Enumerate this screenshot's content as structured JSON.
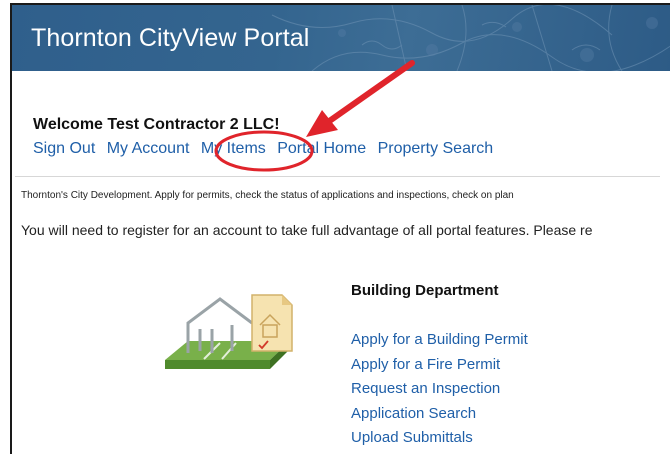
{
  "header": {
    "title": "Thornton CityView Portal"
  },
  "welcome": "Welcome Test Contractor 2 LLC!",
  "nav": {
    "sign_out": "Sign Out",
    "my_account": "My Account",
    "my_items": "My Items",
    "portal_home": "Portal Home",
    "property_search": "Property Search"
  },
  "intro_text": "Thornton's City Development. Apply for permits, check the status of applications and inspections, check on plan",
  "register_text": "You will need to register for an account to take full advantage of all portal features. Please re",
  "building": {
    "title": "Building Department",
    "links": [
      "Apply for a Building Permit",
      "Apply for a Fire Permit",
      "Request an Inspection",
      "Application Search",
      "Upload Submittals"
    ]
  },
  "colors": {
    "header_bg": "#2f5f8c",
    "link": "#1f5fa8",
    "annotation": "#e0242b"
  }
}
